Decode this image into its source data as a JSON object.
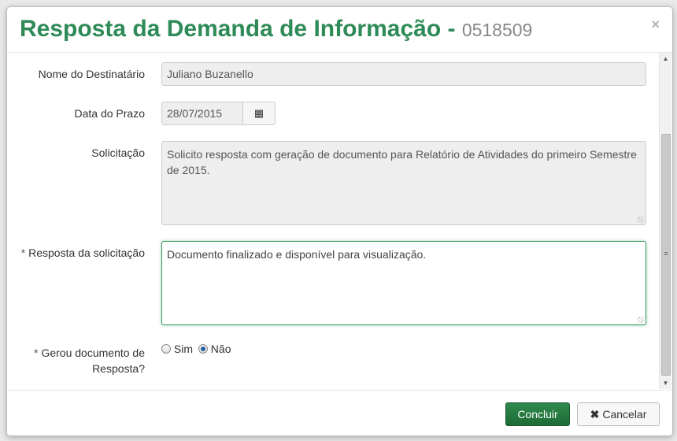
{
  "modal": {
    "title": "Resposta da Demanda de Informação - ",
    "number": "0518509",
    "close": "×"
  },
  "form": {
    "recipient_label": "Nome do Destinatário",
    "recipient_value": "Juliano Buzanello",
    "deadline_label": "Data do Prazo",
    "deadline_value": "28/07/2015",
    "calendar_icon": "▦",
    "request_label": "Solicitação",
    "request_value": "Solicito resposta com geração de documento para Relatório de Atividades do primeiro Semestre de 2015.",
    "response_required": "* ",
    "response_label": "Resposta da solicitação",
    "response_value": "Documento finalizado e disponível para visualização.",
    "generated_required": "* ",
    "generated_label": "Gerou documento de Resposta?",
    "option_yes": "Sim",
    "option_no": "Não",
    "selected": "Não"
  },
  "footer": {
    "confirm": "Concluir",
    "cancel": "Cancelar",
    "cancel_icon": "✖"
  },
  "colors": {
    "title": "#2e8b57",
    "primary_button": "#1d6a36",
    "focus_border": "#3c9a5f"
  }
}
